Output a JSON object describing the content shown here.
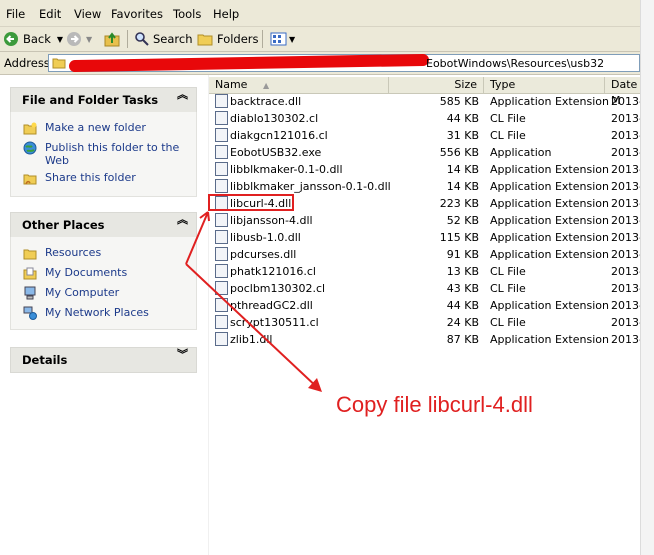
{
  "menu": [
    "File",
    "Edit",
    "View",
    "Favorites",
    "Tools",
    "Help"
  ],
  "toolbar": {
    "back": "Back",
    "search": "Search",
    "folders": "Folders"
  },
  "address": {
    "label": "Address",
    "path_visible": "EobotWindows\\Resources\\usb32"
  },
  "panels": {
    "tasks_title": "File and Folder Tasks",
    "tasks": [
      "Make a new folder",
      "Publish this folder to the Web",
      "Share this folder"
    ],
    "places_title": "Other Places",
    "places": [
      "Resources",
      "My Documents",
      "My Computer",
      "My Network Places"
    ],
    "details_title": "Details"
  },
  "columns": {
    "name": "Name",
    "size": "Size",
    "type": "Type",
    "date": "Date M"
  },
  "files": [
    {
      "name": "backtrace.dll",
      "size": "585 KB",
      "type": "Application Extension",
      "date": "2013-"
    },
    {
      "name": "diablo130302.cl",
      "size": "44 KB",
      "type": "CL File",
      "date": "2013-"
    },
    {
      "name": "diakgcn121016.cl",
      "size": "31 KB",
      "type": "CL File",
      "date": "2013-"
    },
    {
      "name": "EobotUSB32.exe",
      "size": "556 KB",
      "type": "Application",
      "date": "2013-"
    },
    {
      "name": "libblkmaker-0.1-0.dll",
      "size": "14 KB",
      "type": "Application Extension",
      "date": "2013-"
    },
    {
      "name": "libblkmaker_jansson-0.1-0.dll",
      "size": "14 KB",
      "type": "Application Extension",
      "date": "2013-"
    },
    {
      "name": "libcurl-4.dll",
      "size": "223 KB",
      "type": "Application Extension",
      "date": "2013-"
    },
    {
      "name": "libjansson-4.dll",
      "size": "52 KB",
      "type": "Application Extension",
      "date": "2013-"
    },
    {
      "name": "libusb-1.0.dll",
      "size": "115 KB",
      "type": "Application Extension",
      "date": "2013-"
    },
    {
      "name": "pdcurses.dll",
      "size": "91 KB",
      "type": "Application Extension",
      "date": "2013-"
    },
    {
      "name": "phatk121016.cl",
      "size": "13 KB",
      "type": "CL File",
      "date": "2013-"
    },
    {
      "name": "poclbm130302.cl",
      "size": "43 KB",
      "type": "CL File",
      "date": "2013-"
    },
    {
      "name": "pthreadGC2.dll",
      "size": "44 KB",
      "type": "Application Extension",
      "date": "2013-"
    },
    {
      "name": "scrypt130511.cl",
      "size": "24 KB",
      "type": "CL File",
      "date": "2013-"
    },
    {
      "name": "zlib1.dll",
      "size": "87 KB",
      "type": "Application Extension",
      "date": "2013-"
    }
  ],
  "annotation": "Copy file libcurl-4.dll",
  "colors": {
    "annotation": "#e02020",
    "chrome": "#ece9d8",
    "panel_header": "#e7e7e2"
  }
}
